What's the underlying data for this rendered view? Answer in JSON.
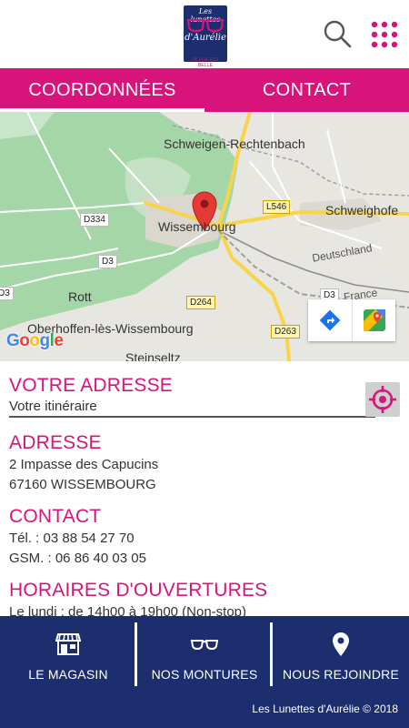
{
  "header": {
    "logo": {
      "line1": "Les lunettes",
      "line2": "d'Aurélie",
      "tagline": "LA VUE EST BELLE"
    },
    "search_icon": "search-icon",
    "menu_icon": "grid-menu-icon"
  },
  "tabs": [
    {
      "label": "COORDONNÉES",
      "active": true
    },
    {
      "label": "CONTACT",
      "active": false
    }
  ],
  "map": {
    "places": {
      "schweigen": "Schweigen-Rechtenbach",
      "wissembourg": "Wissembourg",
      "schweighofen": "Schweighofe",
      "deutschland": "Deutschland",
      "france": "France",
      "rott": "Rott",
      "oberhoffen": "Oberhoffen-lès-Wissembourg",
      "steinseltz": "Steinseltz"
    },
    "roads": {
      "d334": "D334",
      "l546": "L546",
      "d3_a": "D3",
      "d3_b": "D3",
      "d3_c": "D3",
      "d264": "D264",
      "d263": "D263"
    },
    "google": "Google",
    "colors": {
      "forest": "#a5d6a7",
      "land": "#e8e6e1",
      "major_road": "#f9d44a",
      "pin": "#e53935"
    }
  },
  "sections": {
    "votre_adresse": {
      "title": "VOTRE ADRESSE",
      "link": "Votre itinéraire"
    },
    "adresse": {
      "title": "ADRESSE",
      "line1": "2 Impasse des Capucins",
      "line2": "67160 WISSEMBOURG"
    },
    "contact": {
      "title": "CONTACT",
      "tel": "Tél. : 03 88 54 27 70",
      "gsm": "GSM. : 06 86 40 03 05"
    },
    "horaires": {
      "title": "HORAIRES D'OUVERTURES",
      "line1": "Le lundi : de 14h00 à 19h00 (Non-stop)"
    }
  },
  "bottom_nav": {
    "items": [
      {
        "label": "LE MAGASIN",
        "icon": "store-icon"
      },
      {
        "label": "NOS MONTURES",
        "icon": "glasses-icon"
      },
      {
        "label": "NOUS REJOINDRE",
        "icon": "location-pin-icon"
      }
    ],
    "copyright": "Les Lunettes d'Aurélie © 2018"
  },
  "colors": {
    "accent": "#d8147a",
    "navy": "#1c2e6e"
  }
}
